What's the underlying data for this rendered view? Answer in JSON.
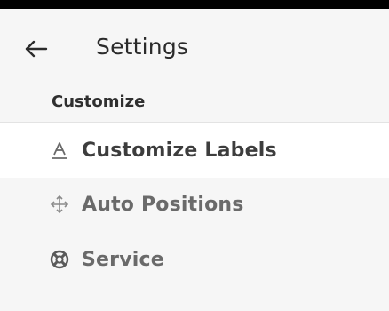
{
  "header": {
    "back_icon": "arrow-left-icon",
    "title": "Settings"
  },
  "section": {
    "title": "Customize"
  },
  "menu": {
    "items": [
      {
        "label": "Customize Labels",
        "icon": "text-label-icon",
        "selected": true,
        "color": "#3d3d3d"
      },
      {
        "label": "Auto Positions",
        "icon": "move-arrows-icon",
        "selected": false,
        "color": "#6a6a6a"
      },
      {
        "label": "Service",
        "icon": "lifebuoy-icon",
        "selected": false,
        "color": "#6a6a6a"
      }
    ]
  },
  "colors": {
    "background": "#f6f6f6",
    "selected_background": "#ffffff",
    "top_strip": "#000000",
    "title_text": "#2b2b2b"
  }
}
